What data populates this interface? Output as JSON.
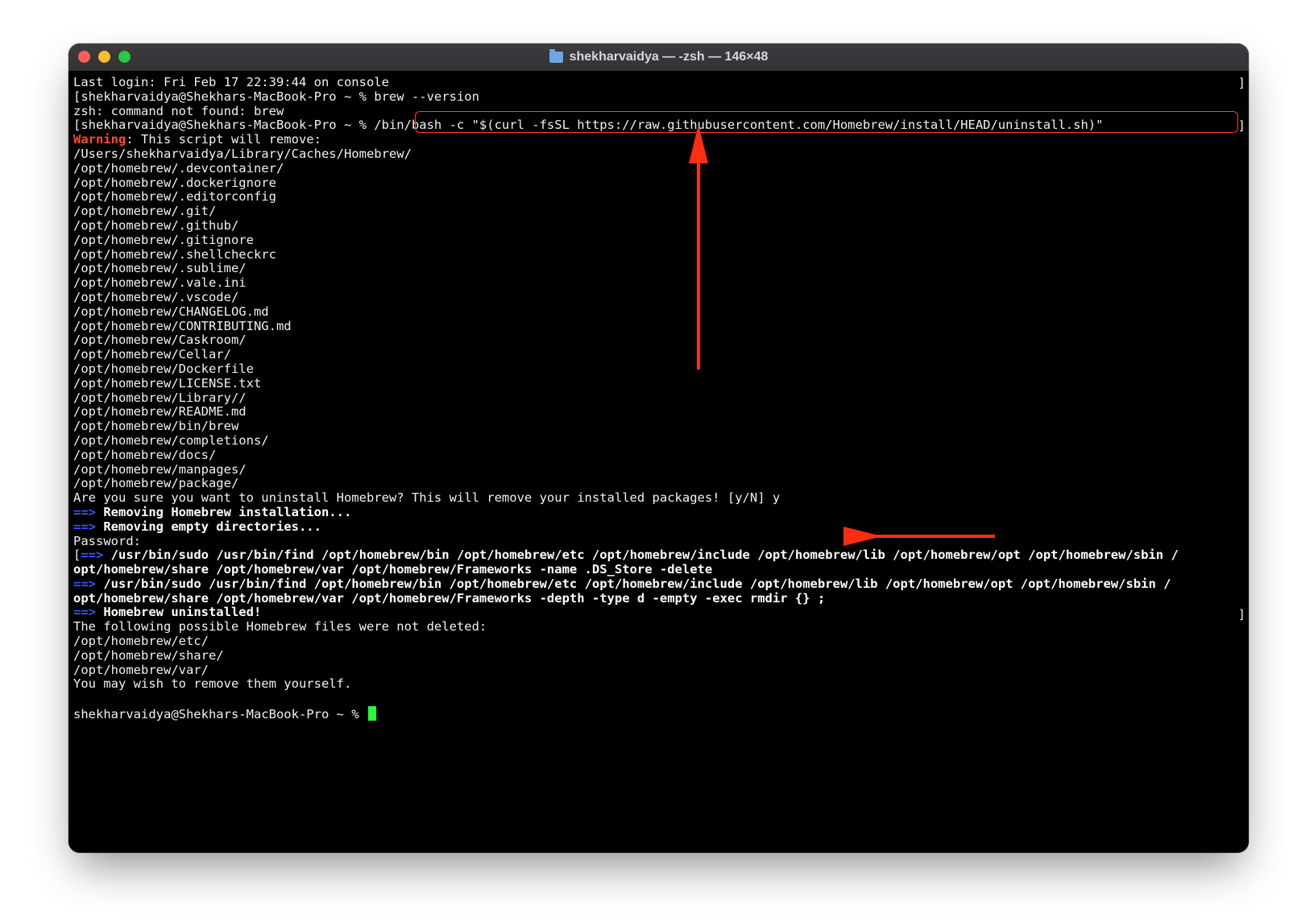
{
  "window": {
    "title": "shekharvaidya — -zsh — 146×48"
  },
  "prompt": {
    "user_host": "shekharvaidya@Shekhars-MacBook-Pro",
    "symbol": "~ %"
  },
  "lines": {
    "last_login": "Last login: Fri Feb 17 22:39:44 on console",
    "cmd_version": "brew --version",
    "err_notfound": "zsh: command not found: brew",
    "cmd_uninstall": "/bin/bash -c \"$(curl -fsSL https://raw.githubusercontent.com/Homebrew/install/HEAD/uninstall.sh)\"",
    "warn_label": "Warning",
    "warn_msg": ": This script will remove:",
    "paths": [
      "/Users/shekharvaidya/Library/Caches/Homebrew/",
      "/opt/homebrew/.devcontainer/",
      "/opt/homebrew/.dockerignore",
      "/opt/homebrew/.editorconfig",
      "/opt/homebrew/.git/",
      "/opt/homebrew/.github/",
      "/opt/homebrew/.gitignore",
      "/opt/homebrew/.shellcheckrc",
      "/opt/homebrew/.sublime/",
      "/opt/homebrew/.vale.ini",
      "/opt/homebrew/.vscode/",
      "/opt/homebrew/CHANGELOG.md",
      "/opt/homebrew/CONTRIBUTING.md",
      "/opt/homebrew/Caskroom/",
      "/opt/homebrew/Cellar/",
      "/opt/homebrew/Dockerfile",
      "/opt/homebrew/LICENSE.txt",
      "/opt/homebrew/Library//",
      "/opt/homebrew/README.md",
      "/opt/homebrew/bin/brew",
      "/opt/homebrew/completions/",
      "/opt/homebrew/docs/",
      "/opt/homebrew/manpages/",
      "/opt/homebrew/package/"
    ],
    "confirm": "Are you sure you want to uninstall Homebrew? This will remove your installed packages! [y/N] y",
    "arrow": "==>",
    "step1": " Removing Homebrew installation...",
    "step2": " Removing empty directories...",
    "password": "Password:",
    "sudo1a": " /usr/bin/sudo /usr/bin/find /opt/homebrew/bin /opt/homebrew/etc /opt/homebrew/include /opt/homebrew/lib /opt/homebrew/opt /opt/homebrew/sbin /",
    "sudo1b": "opt/homebrew/share /opt/homebrew/var /opt/homebrew/Frameworks -name .DS_Store -delete",
    "sudo2a": " /usr/bin/sudo /usr/bin/find /opt/homebrew/bin /opt/homebrew/etc /opt/homebrew/include /opt/homebrew/lib /opt/homebrew/opt /opt/homebrew/sbin /",
    "sudo2b": "opt/homebrew/share /opt/homebrew/var /opt/homebrew/Frameworks -depth -type d -empty -exec rmdir {} ;",
    "done": " Homebrew uninstalled!",
    "leftover_hdr": "The following possible Homebrew files were not deleted:",
    "leftover": [
      "/opt/homebrew/etc/",
      "/opt/homebrew/share/",
      "/opt/homebrew/var/"
    ],
    "leftover_note": "You may wish to remove them yourself."
  }
}
